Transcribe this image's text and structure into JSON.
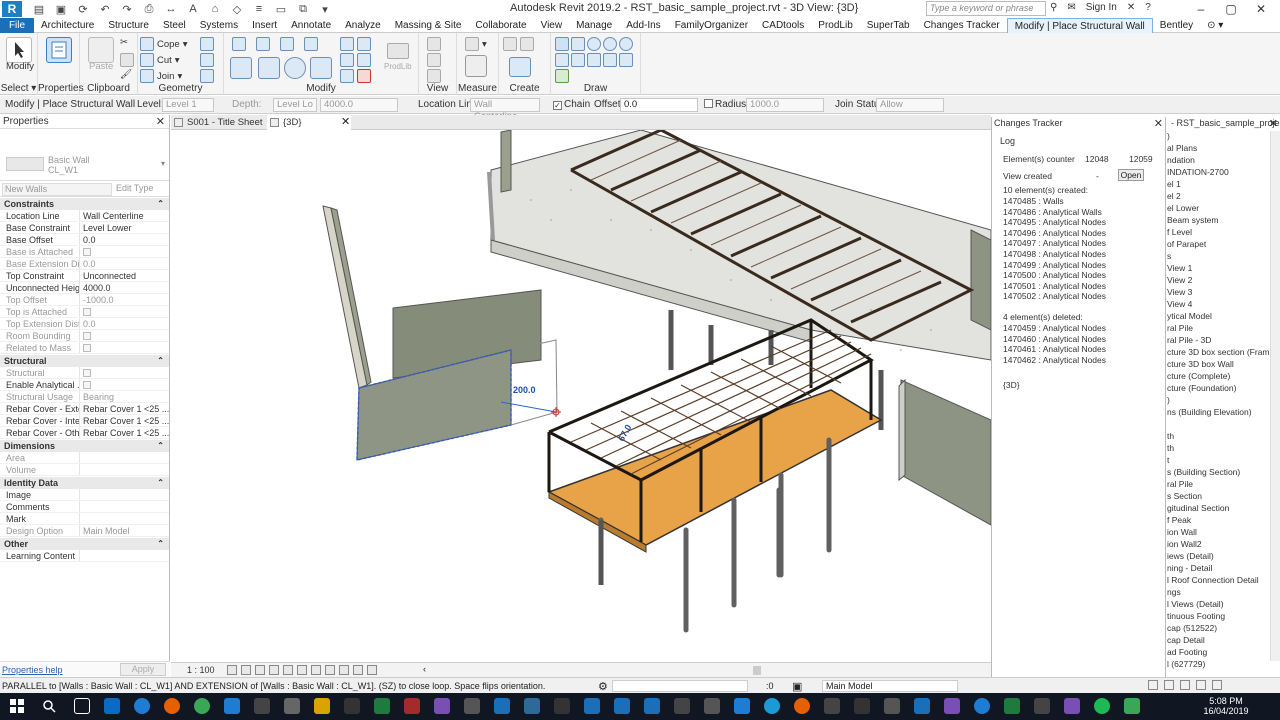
{
  "app": {
    "title": "Autodesk Revit 2019.2 - RST_basic_sample_project.rvt - 3D View: {3D}",
    "badge": "R",
    "search_placeholder": "Type a keyword or phrase",
    "sign_in": "Sign In",
    "accent": "#1b6fb8"
  },
  "ribbon_tabs": [
    "File",
    "Architecture",
    "Structure",
    "Steel",
    "Systems",
    "Insert",
    "Annotate",
    "Analyze",
    "Massing & Site",
    "Collaborate",
    "View",
    "Manage",
    "Add-Ins",
    "FamilyOrganizer",
    "CADtools",
    "ProdLib",
    "SuperTab",
    "Changes Tracker",
    "Modify | Place Structural Wall",
    "Bentley"
  ],
  "ribbon": {
    "modify": "Modify",
    "select": "Select",
    "properties": "Properties",
    "clipboard": "Clipboard",
    "paste": "Paste",
    "cope": "Cope",
    "cut": "Cut",
    "join": "Join",
    "geometry": "Geometry",
    "modify_panel": "Modify",
    "prodlib": "ProdLib",
    "view": "View",
    "measure": "Measure",
    "create": "Create",
    "draw": "Draw"
  },
  "options_bar": {
    "context": "Modify | Place Structural Wall",
    "level_label": "Level:",
    "level_value": "Level 1",
    "depth_label": "Depth:",
    "depth_value": "Level Lo",
    "depth_number": "4000.0",
    "location_label": "Location Line:",
    "location_value": "Wall Centerline",
    "chain_label": "Chain",
    "offset_label": "Offset:",
    "offset_value": "0.0",
    "radius_label": "Radius:",
    "radius_value": "1000.0",
    "join_label": "Join Status:",
    "join_value": "Allow"
  },
  "properties": {
    "title": "Properties",
    "type_family": "Basic Wall",
    "type_name": "CL_W1",
    "instance_filter": "New Walls",
    "edit_type": "Edit Type",
    "groups": [
      {
        "name": "Constraints",
        "rows": [
          {
            "k": "Location Line",
            "v": "Wall Centerline"
          },
          {
            "k": "Base Constraint",
            "v": "Level Lower"
          },
          {
            "k": "Base Offset",
            "v": "0.0"
          },
          {
            "k": "Base is Attached",
            "v": "",
            "dim": true,
            "chk": true
          },
          {
            "k": "Base Extension Dist...",
            "v": "0.0",
            "dim": true
          },
          {
            "k": "Top Constraint",
            "v": "Unconnected"
          },
          {
            "k": "Unconnected Height",
            "v": "4000.0"
          },
          {
            "k": "Top Offset",
            "v": "-1000.0",
            "dim": true
          },
          {
            "k": "Top is Attached",
            "v": "",
            "dim": true,
            "chk": true
          },
          {
            "k": "Top Extension Dist...",
            "v": "0.0",
            "dim": true
          },
          {
            "k": "Room Bounding",
            "v": "",
            "dim": true,
            "chk": true
          },
          {
            "k": "Related to Mass",
            "v": "",
            "dim": true,
            "chk": true
          }
        ]
      },
      {
        "name": "Structural",
        "rows": [
          {
            "k": "Structural",
            "v": "",
            "dim": true,
            "chk": true
          },
          {
            "k": "Enable Analytical ...",
            "v": "",
            "chk": true
          },
          {
            "k": "Structural Usage",
            "v": "Bearing",
            "dim": true
          },
          {
            "k": "Rebar Cover - Exter...",
            "v": "Rebar Cover 1 <25 ..."
          },
          {
            "k": "Rebar Cover - Interi...",
            "v": "Rebar Cover 1 <25 ..."
          },
          {
            "k": "Rebar Cover - Othe...",
            "v": "Rebar Cover 1 <25 ..."
          }
        ]
      },
      {
        "name": "Dimensions",
        "rows": [
          {
            "k": "Area",
            "v": "",
            "dim": true
          },
          {
            "k": "Volume",
            "v": "",
            "dim": true
          }
        ]
      },
      {
        "name": "Identity Data",
        "rows": [
          {
            "k": "Image",
            "v": ""
          },
          {
            "k": "Comments",
            "v": ""
          },
          {
            "k": "Mark",
            "v": ""
          },
          {
            "k": "Design Option",
            "v": "Main Model",
            "dim": true
          }
        ]
      },
      {
        "name": "Other",
        "rows": [
          {
            "k": "Learning Content",
            "v": ""
          }
        ]
      }
    ],
    "help": "Properties help",
    "apply": "Apply"
  },
  "view_tabs": [
    {
      "label": "S001 - Title Sheet",
      "active": false
    },
    {
      "label": "{3D}",
      "active": true
    }
  ],
  "viewport": {
    "dim_temp_1": "200.0",
    "dim_temp_2": "67.0",
    "scale": "1 : 100"
  },
  "tracker": {
    "title": "Changes Tracker",
    "tab": "Log",
    "counter_label": "Element(s) counter",
    "counter_a": "12048",
    "counter_b": "12059",
    "view_created_label": "View created",
    "view_created_value": "-",
    "open_button": "Open",
    "created_header": "10 element(s) created:",
    "created": [
      "1470485 : Walls",
      "1470486 : Analytical Walls",
      "1470495 : Analytical Nodes",
      "1470496 : Analytical Nodes",
      "1470497 : Analytical Nodes",
      "1470498 : Analytical Nodes",
      "1470499 : Analytical Nodes",
      "1470500 : Analytical Nodes",
      "1470501 : Analytical Nodes",
      "1470502 : Analytical Nodes"
    ],
    "deleted_header": "4 element(s) deleted:",
    "deleted": [
      "1470459 : Analytical Nodes",
      "1470460 : Analytical Nodes",
      "1470461 : Analytical Nodes",
      "1470462 : Analytical Nodes"
    ],
    "view_tag": "{3D}"
  },
  "browser": {
    "title": "- RST_basic_sample_project...",
    "items": [
      ")",
      "al Plans",
      "ndation",
      "INDATION-2700",
      "el 1",
      "el 2",
      "el Lower",
      "Beam system",
      "f Level",
      "of Parapet",
      "s",
      "View 1",
      "View 2",
      "View 3",
      "View 4",
      "ytical Model",
      "ral Pile",
      "ral Pile - 3D",
      "cture 3D box section (Framing)",
      "cture 3D box Wall",
      "cture (Complete)",
      "cture (Foundation)",
      ")",
      "ns (Building Elevation)",
      "",
      "th",
      "th",
      "t",
      "s (Building Section)",
      "ral Pile",
      "s Section",
      "gitudinal Section",
      "f Peak",
      "ion Wall",
      "ion Wall2",
      "iews (Detail)",
      "ning - Detail",
      "l Roof Connection Detail",
      "ngs",
      "l Views (Detail)",
      "tinuous Footing",
      "cap (512522)",
      "cap Detail",
      "ad Footing",
      "l (627729)"
    ]
  },
  "statusbar": {
    "message": "PARALLEL  to [Walls : Basic Wall : CL_W1] AND EXTENSION  of [Walls : Basic Wall : CL_W1]. (SZ) to close loop. Space flips orientation.",
    "zero": ":0",
    "model": "Main Model"
  },
  "taskbar": {
    "time": "5:08 PM",
    "date": "16/04/2019"
  }
}
